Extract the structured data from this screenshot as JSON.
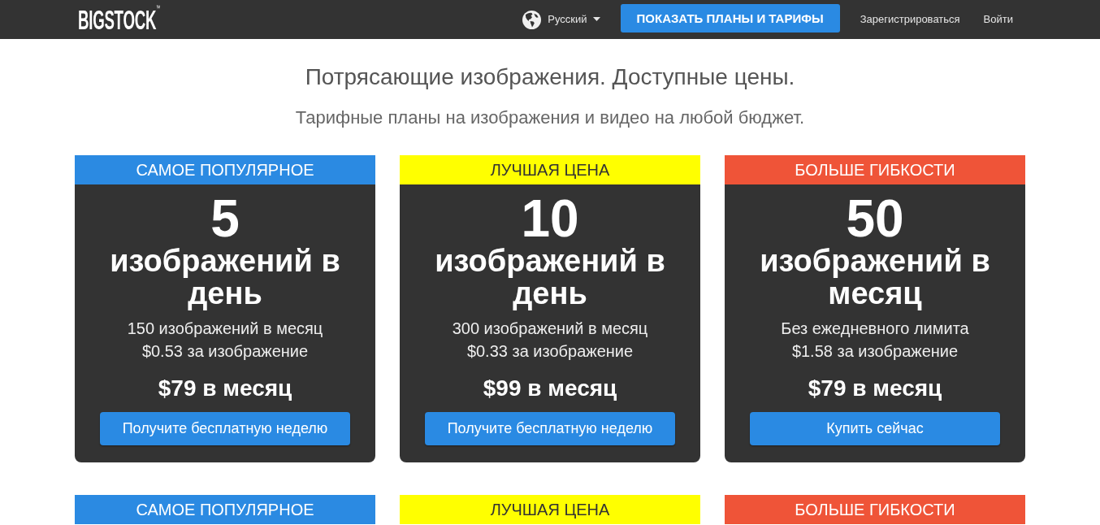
{
  "navbar": {
    "logo": "BIGSTOCK$^{™}$",
    "language": "Русский",
    "cta_button": "ПОКАЗАТЬ ПЛАНЫ И ТАРИФЫ",
    "links": [
      "Зарегистрироваться",
      "Войти"
    ]
  },
  "hero": {
    "title": "Потрясающие изображения. Доступные цены.",
    "subtitle": "Тарифные планы на изображения и видео на любой бюджет."
  },
  "plans": [
    {
      "label": "САМОЕ ПОПУЛЯРНОЕ",
      "color": "#2b8ae2",
      "amount": "5",
      "unit": "изображений в день",
      "details": [
        "150 изображений в месяц",
        "$0.53 за изображение"
      ],
      "price": "$79 в месяц",
      "button": "Получите бесплатную неделю"
    },
    {
      "label": "ЛУЧШАЯ ЦЕНА",
      "color": "#ffff00",
      "amount": "10",
      "unit": "изображений в день",
      "details": [
        "300 изображений в месяц",
        "$0.33 за изображение"
      ],
      "price": "$99 в месяц",
      "button": "Получите бесплатную неделю"
    },
    {
      "label": "БОЛЬШЕ ГИБКОСТИ",
      "color": "#ef5438",
      "amount": "50",
      "unit": "изображений в месяц",
      "details": [
        "Без ежедневного лимита",
        "$1.58 за изображение"
      ],
      "price": "$79 в месяц",
      "button": "Купить сейчас"
    }
  ],
  "more_plans": [
    {
      "label": "САМОЕ ПОПУЛЯРНОЕ",
      "color": "#2b8ae2"
    },
    {
      "label": "ЛУЧШАЯ ЦЕНА",
      "color": "#ffff00"
    },
    {
      "label": "БОЛЬШЕ ГИБКОСТИ",
      "color": "#ef5438"
    }
  ]
}
